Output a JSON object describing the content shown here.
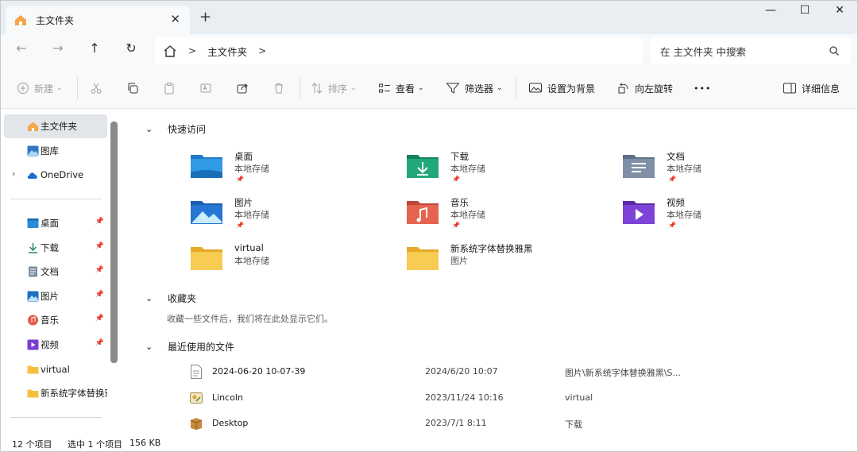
{
  "tab": {
    "title": "主文件夹",
    "close": "✕",
    "new": "+"
  },
  "window_controls": {
    "minimize": "—",
    "maximize": "☐",
    "close": "✕"
  },
  "address": {
    "path": "主文件夹",
    "search_placeholder": "在 主文件夹 中搜索"
  },
  "toolbar": {
    "new_label": "新建",
    "sort_label": "排序",
    "view_label": "查看",
    "filter_label": "筛选器",
    "set_bg_label": "设置为背景",
    "rotate_label": "向左旋转",
    "more_label": "•••",
    "details_label": "详细信息"
  },
  "sidebar": {
    "home": "主文件夹",
    "gallery": "图库",
    "onedrive": "OneDrive",
    "pinned": [
      {
        "label": "桌面"
      },
      {
        "label": "下载"
      },
      {
        "label": "文档"
      },
      {
        "label": "图片"
      },
      {
        "label": "音乐"
      },
      {
        "label": "视频"
      },
      {
        "label": "virtual"
      },
      {
        "label": "新系统字体替换雅"
      }
    ]
  },
  "quick_access": {
    "heading": "快速访问",
    "items": [
      {
        "name": "桌面",
        "sub": "本地存储"
      },
      {
        "name": "下载",
        "sub": "本地存储"
      },
      {
        "name": "文档",
        "sub": "本地存储"
      },
      {
        "name": "图片",
        "sub": "本地存储"
      },
      {
        "name": "音乐",
        "sub": "本地存储"
      },
      {
        "name": "视频",
        "sub": "本地存储"
      },
      {
        "name": "virtual",
        "sub": "本地存储"
      },
      {
        "name": "新系统字体替换雅黑",
        "sub": "图片"
      }
    ]
  },
  "favorites": {
    "heading": "收藏夹",
    "empty": "收藏一些文件后，我们将在此处显示它们。"
  },
  "recent": {
    "heading": "最近使用的文件",
    "rows": [
      {
        "name": "2024-06-20 10-07-39",
        "date": "2024/6/20 10:07",
        "location": "图片\\新系统字体替换雅黑\\S..."
      },
      {
        "name": "Lincoln",
        "date": "2023/11/24 10:16",
        "location": "virtual"
      },
      {
        "name": "Desktop",
        "date": "2023/7/1 8:11",
        "location": "下载"
      }
    ]
  },
  "status": {
    "count": "12 个项目",
    "selected": "选中 1 个项目",
    "size": "156 KB"
  }
}
